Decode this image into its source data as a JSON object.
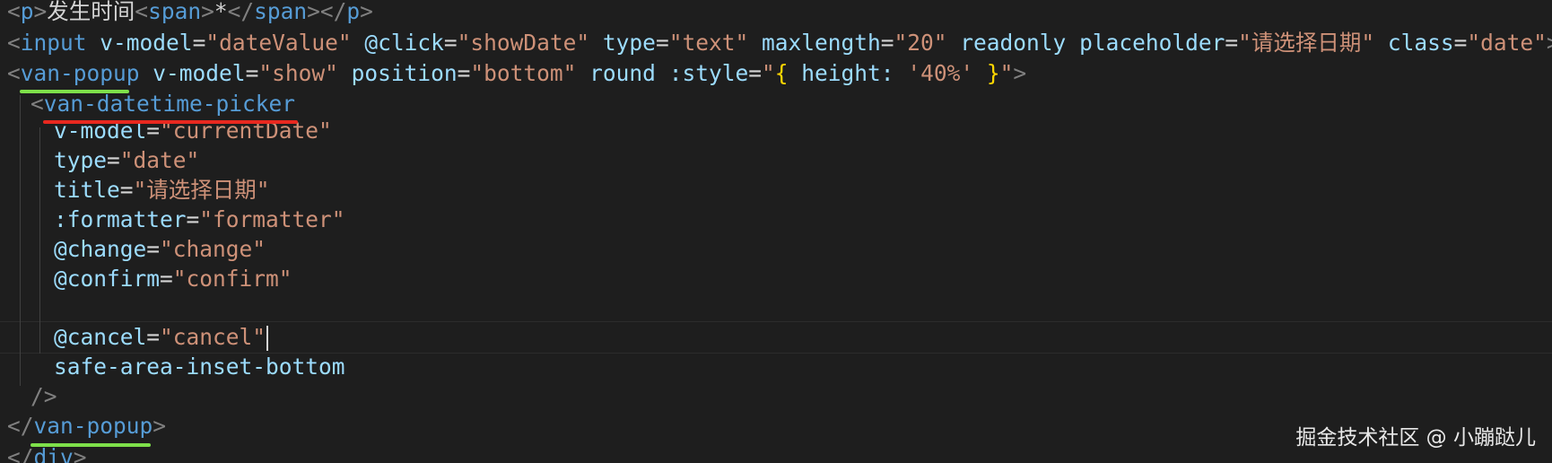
{
  "code": {
    "line1": {
      "text_a": "发生时间",
      "text_b": "*"
    },
    "line2": {
      "tag": "input",
      "attr1": "v-model",
      "val1": "\"dateValue\"",
      "attr2": "@click",
      "val2": "\"showDate\"",
      "attr3": "type",
      "val3": "\"text\"",
      "attr4": "maxlength",
      "val4": "\"20\"",
      "attr5": "readonly",
      "attr6": "placeholder",
      "val6": "\"请选择日期\"",
      "attr7": "class",
      "val7": "\"date\""
    },
    "line3": {
      "tag": "van-popup",
      "attr1": "v-model",
      "val1": "\"show\"",
      "attr2": "position",
      "val2": "\"bottom\"",
      "attr3": "round",
      "attr4": ":style",
      "style_prop": "height:",
      "style_val": "'40%'"
    },
    "line4": {
      "tag": "van-datetime-picker"
    },
    "line5": {
      "attr": "v-model",
      "val": "\"currentDate\""
    },
    "line6": {
      "attr": "type",
      "val": "\"date\""
    },
    "line7": {
      "attr": "title",
      "val": "\"请选择日期\""
    },
    "line8": {
      "attr": ":formatter",
      "val": "\"formatter\""
    },
    "line9": {
      "attr": "@change",
      "val": "\"change\""
    },
    "line10": {
      "attr": "@confirm",
      "val": "\"confirm\""
    },
    "line11": {
      "attr": "@cancel",
      "val": "\"cancel\""
    },
    "line12": {
      "attr": "safe-area-inset-bottom"
    },
    "line14": {
      "tag": "van-popup"
    }
  },
  "watermark": "掘金技术社区 @ 小蹦跶儿",
  "colors": {
    "background": "#1e1e1e",
    "tag": "#569cd6",
    "attribute": "#9cdcfe",
    "string": "#ce9178",
    "green_underline": "#7ee04a",
    "red_underline": "#e8281f"
  }
}
